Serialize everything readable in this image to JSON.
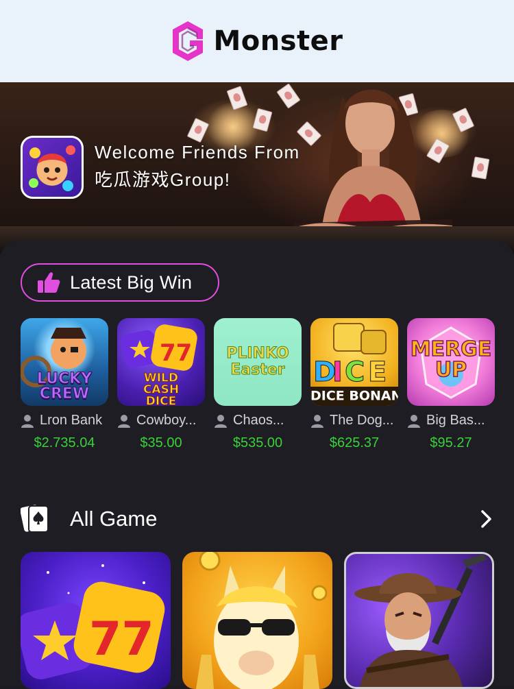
{
  "header": {
    "brand": "Monster",
    "logo_icon": "monster-logo-icon",
    "logo_color": "#e535c8"
  },
  "banner": {
    "welcome_line1": "Welcome Friends From",
    "welcome_line2": "吃瓜游戏Group!"
  },
  "latest": {
    "label": "Latest Big Win",
    "icon": "thumbs-up-icon",
    "accent": "#e04fe0",
    "items": [
      {
        "art": "LUCKY CREW",
        "user": "Lron Bank",
        "amount": "$2.735.04"
      },
      {
        "art": "WILD CASH DICE",
        "user": "Cowboy...",
        "amount": "$35.00"
      },
      {
        "art": "PLINKO Easter",
        "user": "Chaos...",
        "amount": "$535.00"
      },
      {
        "art": "DICE BONANZA",
        "user": "The Dog...",
        "amount": "$625.37"
      },
      {
        "art": "MERGE UP",
        "user": "Big Bas...",
        "amount": "$95.27"
      }
    ]
  },
  "all_game": {
    "label": "All Game",
    "icon": "playing-cards-icon",
    "arrow_icon": "chevron-right-icon"
  },
  "colors": {
    "amount_green": "#3ad13a",
    "panel_bg": "#1e1d24",
    "header_bg": "#e9f1fb"
  }
}
